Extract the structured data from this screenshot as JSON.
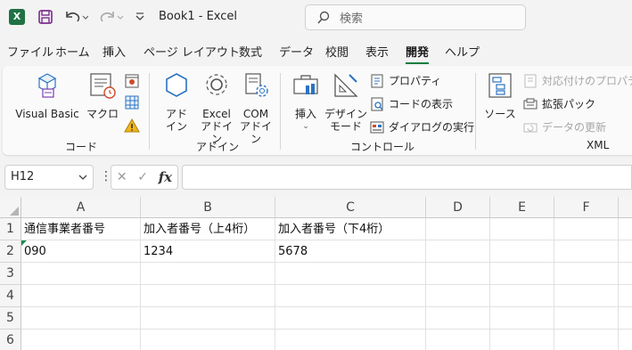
{
  "titlebar": {
    "app_icon": "excel-icon",
    "app_icon_letter": "X",
    "title": "Book1  -  Excel",
    "search_placeholder": "検索"
  },
  "tabs": [
    {
      "label": "ファイル"
    },
    {
      "label": "ホーム"
    },
    {
      "label": "挿入"
    },
    {
      "label": "ページ レイアウト"
    },
    {
      "label": "数式"
    },
    {
      "label": "データ"
    },
    {
      "label": "校閲"
    },
    {
      "label": "表示"
    },
    {
      "label": "開発",
      "active": true
    },
    {
      "label": "ヘルプ"
    }
  ],
  "ribbon": {
    "code": {
      "visual_basic": "Visual Basic",
      "macro": "マクロ",
      "group": "コード"
    },
    "addin": {
      "addin1": "アド\nイン",
      "addin1_l1": "アド",
      "addin1_l2": "イン",
      "excel_l1": "Excel",
      "excel_l2": "アドイン",
      "com_l1": "COM",
      "com_l2": "アドイン",
      "group": "アドイン"
    },
    "controls": {
      "insert": "挿入",
      "design_l1": "デザイン",
      "design_l2": "モード",
      "properties": "プロパティ",
      "view_code": "コードの表示",
      "run_dialog": "ダイアログの実行",
      "group": "コントロール"
    },
    "xml": {
      "source": "ソース",
      "map_properties": "対応付けのプロパティ",
      "expansion_packs": "拡張パック",
      "refresh_data": "データの更新",
      "group": "XML"
    }
  },
  "formula_bar": {
    "name_box": "H12",
    "fx_label": "fx",
    "formula": ""
  },
  "sheet": {
    "columns": [
      "A",
      "B",
      "C",
      "D",
      "E",
      "F"
    ],
    "rows": [
      "1",
      "2",
      "3",
      "4",
      "5",
      "6"
    ],
    "cells": [
      [
        "通信事業者番号",
        "加入者番号（上4桁）",
        "加入者番号（下4桁）",
        "",
        "",
        ""
      ],
      [
        "090",
        "1234",
        "5678",
        "",
        "",
        ""
      ],
      [
        "",
        "",
        "",
        "",
        "",
        ""
      ],
      [
        "",
        "",
        "",
        "",
        "",
        ""
      ],
      [
        "",
        "",
        "",
        "",
        "",
        ""
      ],
      [
        "",
        "",
        "",
        "",
        "",
        ""
      ]
    ]
  },
  "colors": {
    "excel_green": "#1f7244",
    "accent_green": "#107c41",
    "icon_blue": "#2b73c2"
  }
}
